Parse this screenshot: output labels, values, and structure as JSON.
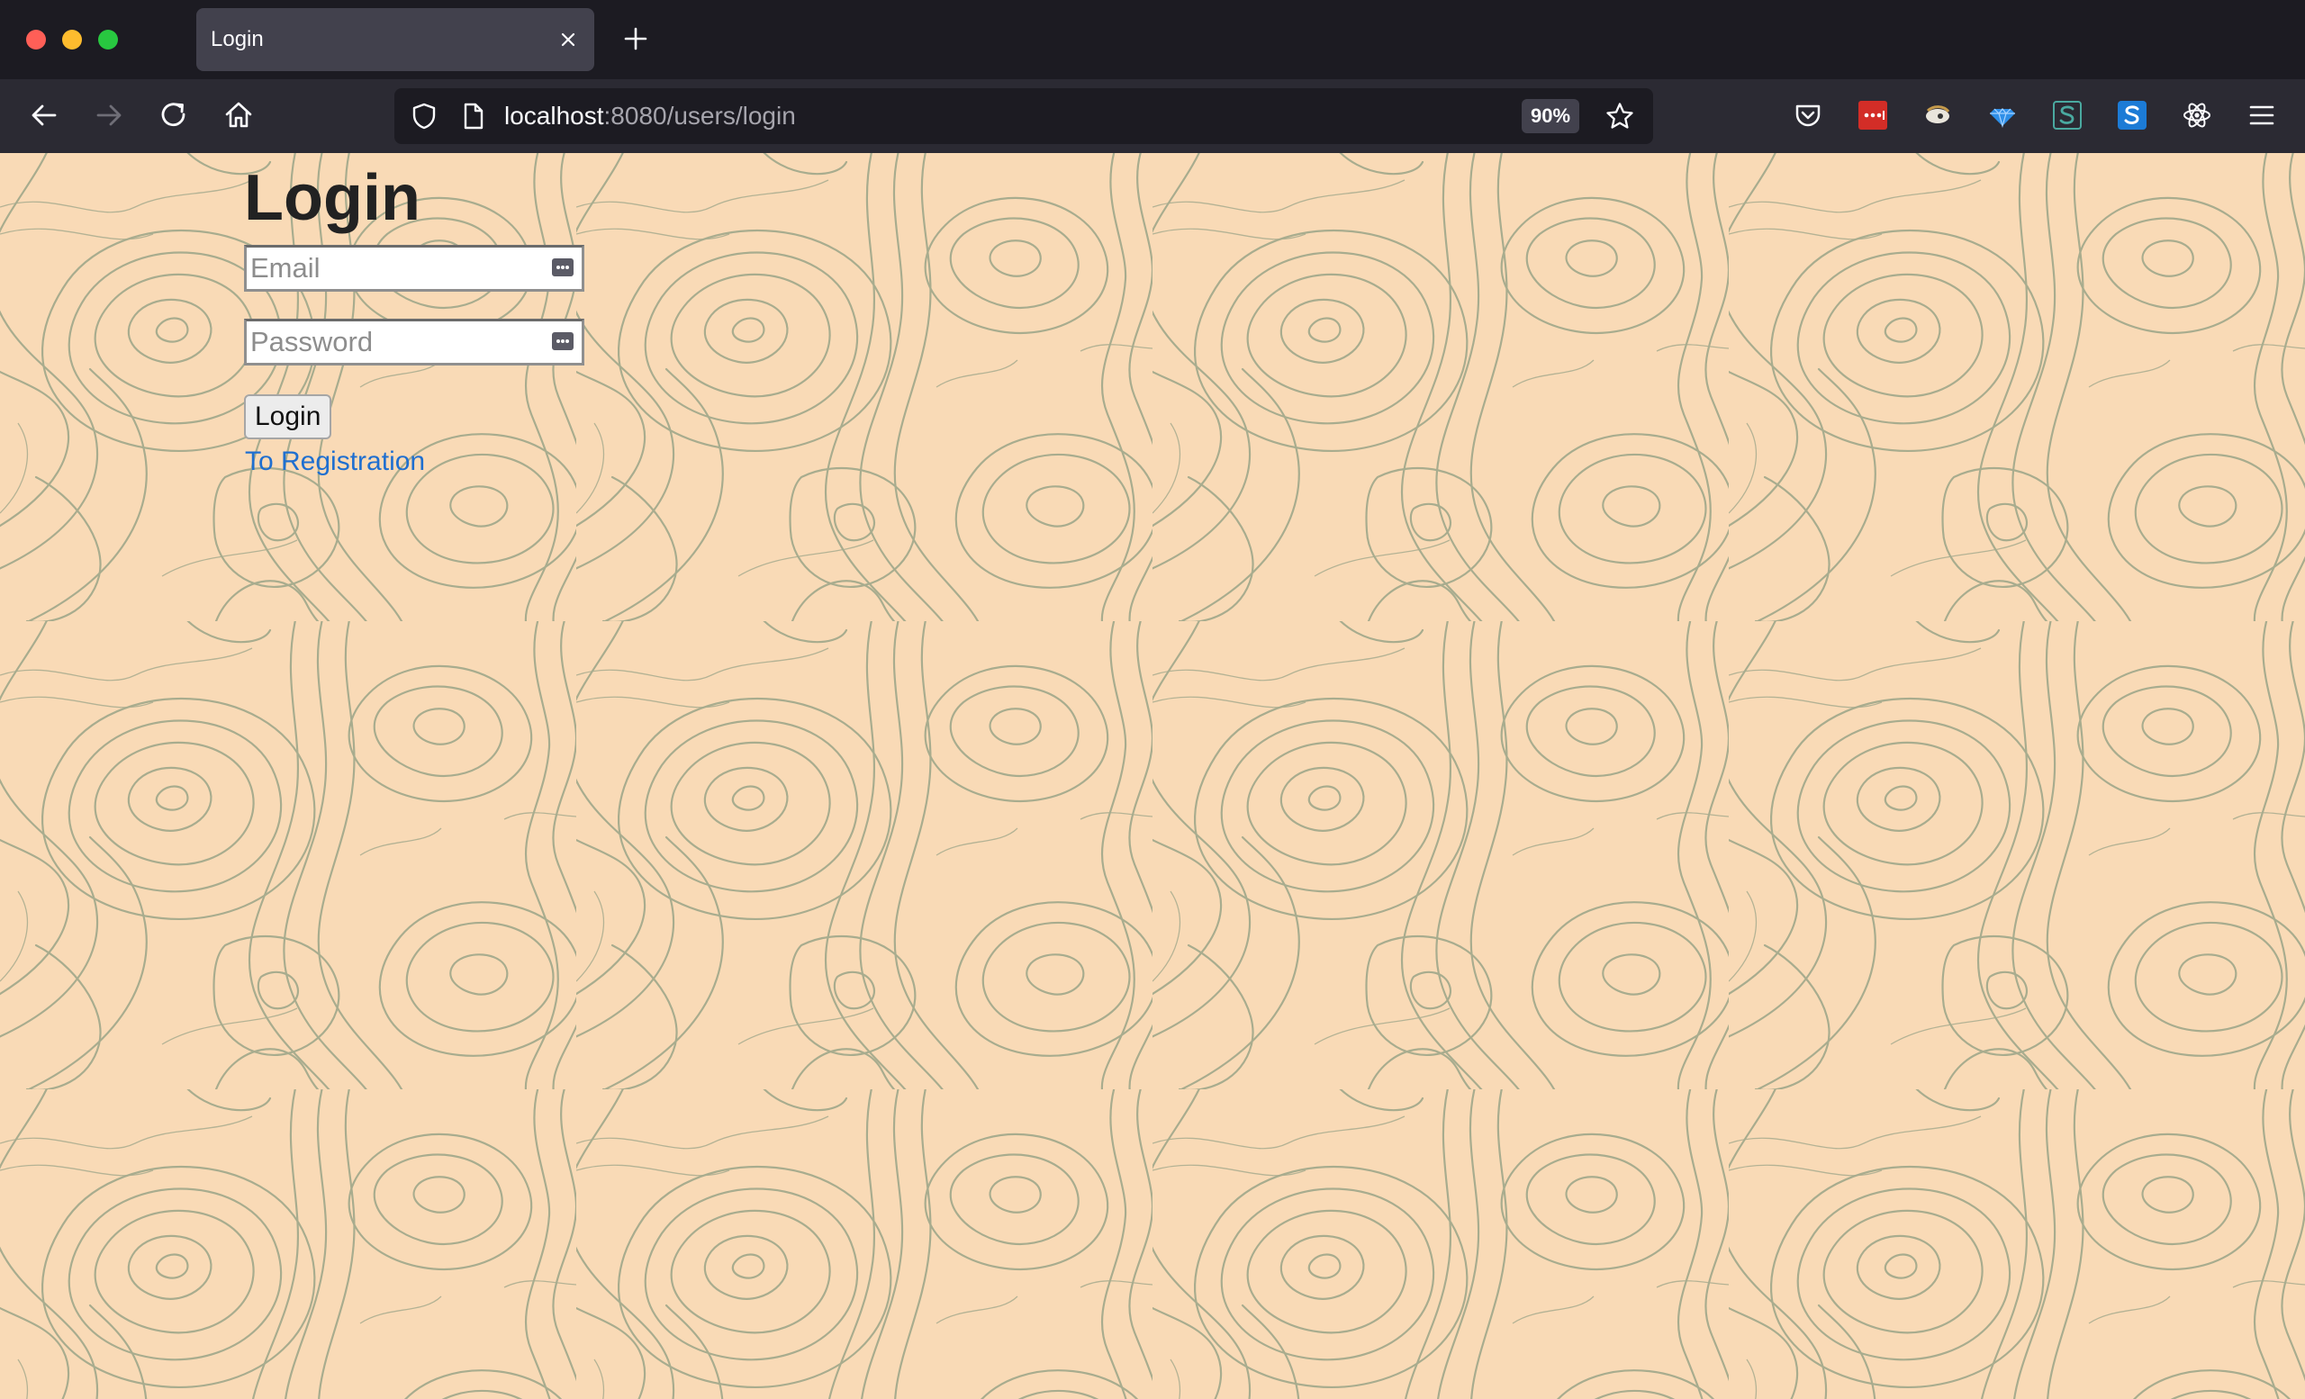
{
  "browser": {
    "tab": {
      "title": "Login"
    },
    "address": {
      "host": "localhost",
      "rest": ":8080/users/login"
    },
    "zoom": "90%"
  },
  "colors": {
    "page_background": "#f9dab6",
    "contour_lines": "#a8ac8e",
    "link": "#1f6fd0",
    "browser_chrome": "#2b2a33"
  },
  "login": {
    "title": "Login",
    "email_placeholder": "Email",
    "password_placeholder": "Password",
    "submit_label": "Login",
    "registration_link": "To Registration"
  },
  "toolbar_icons": [
    "back-icon",
    "forward-icon",
    "reload-icon",
    "home-icon",
    "pocket-icon",
    "lastpass-icon",
    "extension-bird-icon",
    "extension-gem-icon",
    "extension-s-outline-icon",
    "extension-s-blue-icon",
    "react-devtools-icon",
    "menu-icon"
  ]
}
